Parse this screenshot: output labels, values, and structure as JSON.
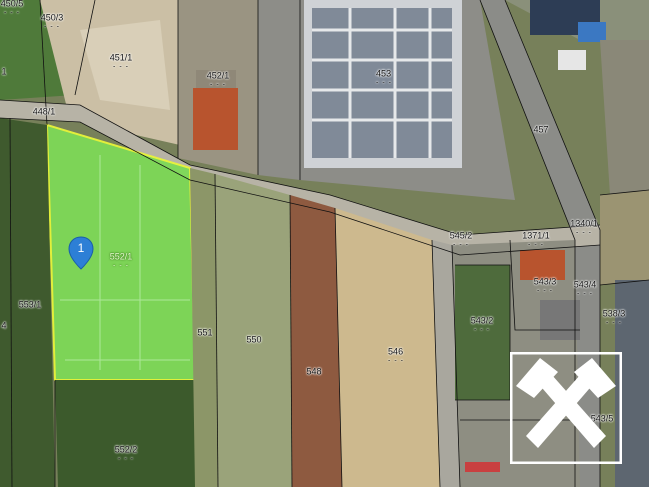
{
  "map": {
    "selected_parcel": "552/1",
    "marker_number": "1",
    "highlight_color": "#7ed957",
    "highlight_border": "#e8f53a",
    "parcels": [
      {
        "id": "p-450-5",
        "label": "450/5"
      },
      {
        "id": "p-450-3",
        "label": "450/3"
      },
      {
        "id": "p-451-1",
        "label": "451/1"
      },
      {
        "id": "p-452-1",
        "label": "452/1"
      },
      {
        "id": "p-453",
        "label": "453"
      },
      {
        "id": "p-457",
        "label": "457"
      },
      {
        "id": "p-448-1",
        "label": "448/1"
      },
      {
        "id": "p-552-1",
        "label": "552/1"
      },
      {
        "id": "p-553-1",
        "label": "553/1"
      },
      {
        "id": "p-551",
        "label": "551"
      },
      {
        "id": "p-550",
        "label": "550"
      },
      {
        "id": "p-548",
        "label": "548"
      },
      {
        "id": "p-546",
        "label": "546"
      },
      {
        "id": "p-545-2",
        "label": "545/2"
      },
      {
        "id": "p-1371-1",
        "label": "1371/1"
      },
      {
        "id": "p-1340-1",
        "label": "1340/1"
      },
      {
        "id": "p-543-3",
        "label": "543/3"
      },
      {
        "id": "p-543-4",
        "label": "543/4"
      },
      {
        "id": "p-538-3",
        "label": "538/3"
      },
      {
        "id": "p-543-2",
        "label": "543/2"
      },
      {
        "id": "p-543-5",
        "label": "543/5"
      },
      {
        "id": "p-552-2",
        "label": "552/2"
      },
      {
        "id": "p-1-left",
        "label": "1"
      },
      {
        "id": "p-4-left",
        "label": "4"
      }
    ],
    "dots": "- - -"
  }
}
